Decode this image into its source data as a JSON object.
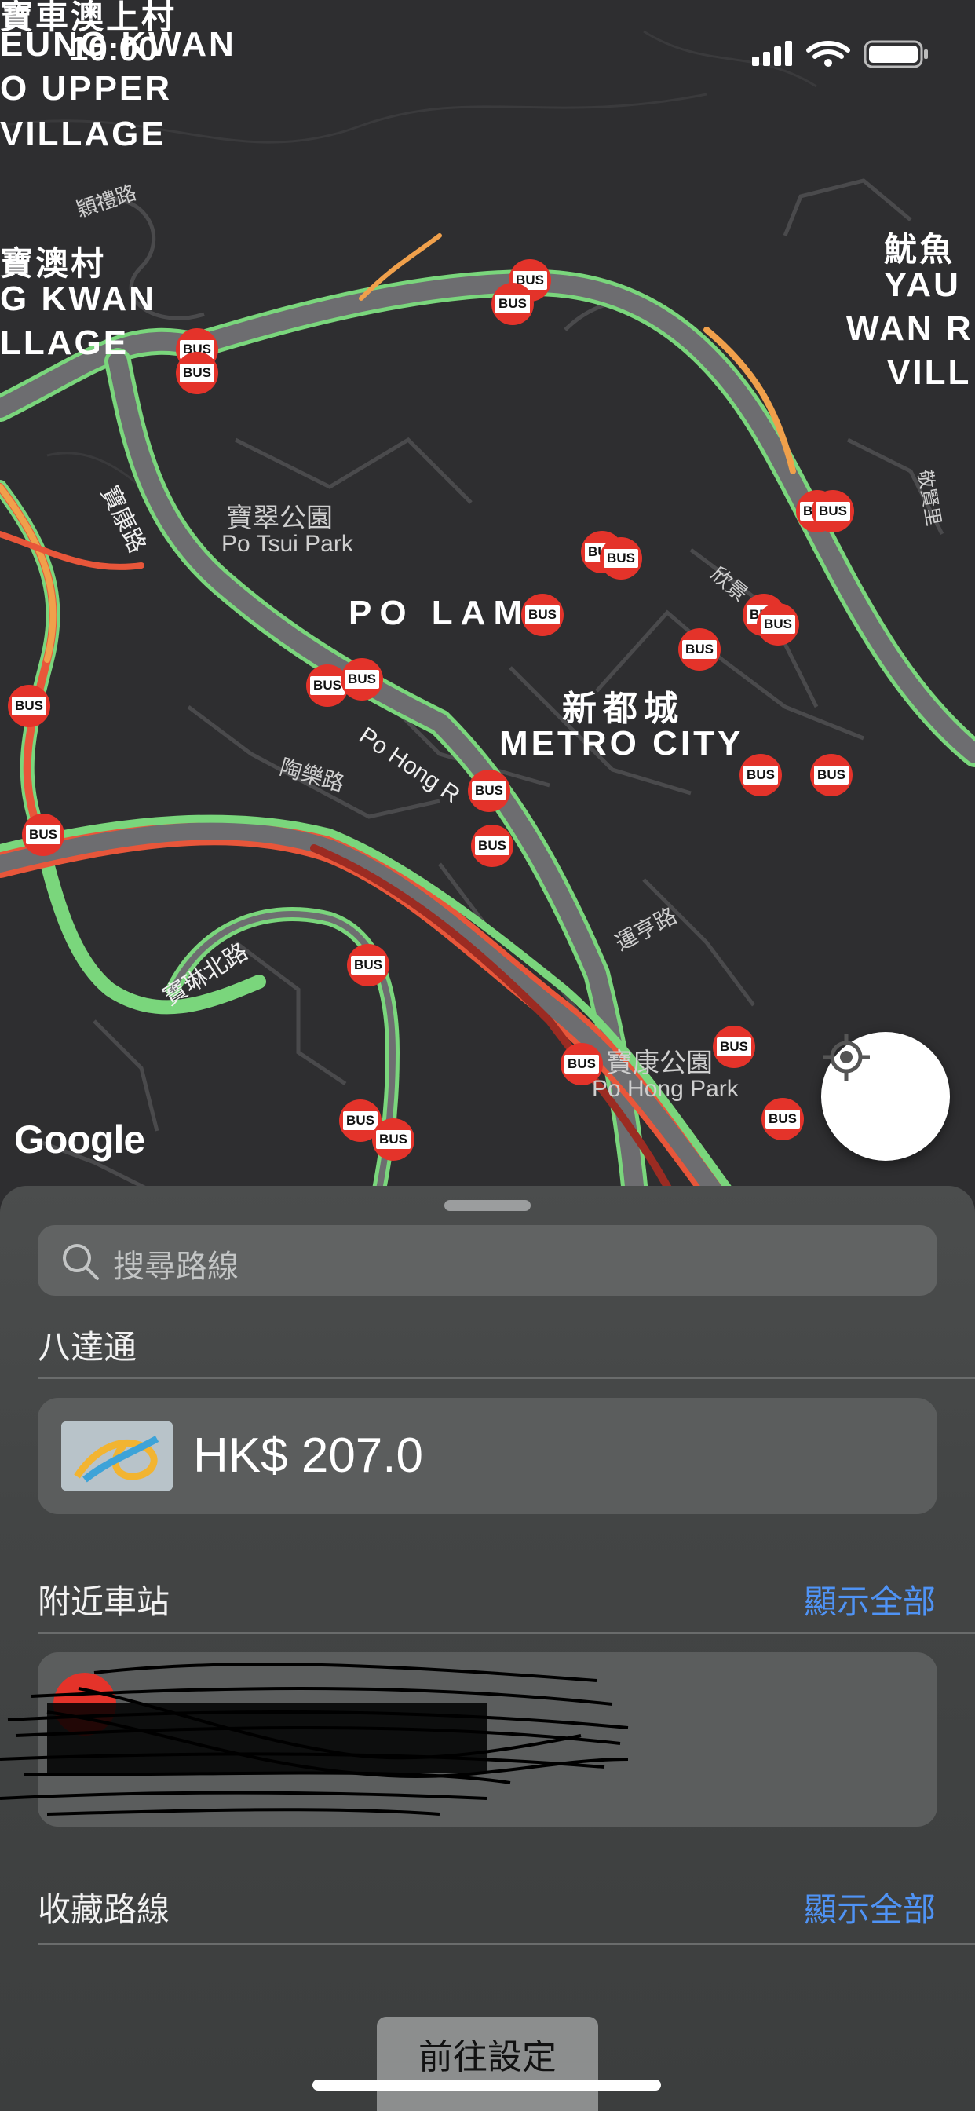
{
  "status_bar": {
    "time": "10:00"
  },
  "map": {
    "labels": {
      "upper_village_zh": "寶車澳上村",
      "upper_village_en1": "EUNG KWAN",
      "upper_village_en2": "O UPPER",
      "upper_village_en3": "VILLAGE",
      "village_zh": "寶澳村",
      "village_en1": "G KWAN",
      "village_en2": "LLAGE",
      "yau_yue_zh": "魷魚",
      "yau_yue_en1": "YAU",
      "yau_yue_en2": "WAN R",
      "yau_yue_en3": "VILL",
      "po_lam": "PO LAM",
      "metro_zh": "新都城",
      "metro_en": "METRO CITY",
      "po_tsui_zh": "寶翠公園",
      "po_tsui_en": "Po Tsui Park",
      "po_hong_zh": "寶康公園",
      "po_hong_en": "Po Hong Park",
      "po_hong_rd": "Po Hong R",
      "road1": "穎禮路",
      "road2": "寶康路",
      "road3": "陶樂路",
      "road4": "運亨路",
      "road5": "寶琳北路",
      "road6": "欣景",
      "road7": "敬賢里"
    },
    "bus_label": "BUS",
    "google": "Google"
  },
  "sheet": {
    "search_placeholder": "搜尋路線",
    "octopus": {
      "title": "八達通",
      "balance": "HK$ 207.0"
    },
    "nearby": {
      "title": "附近車站",
      "show_all": "顯示全部"
    },
    "favourites": {
      "title": "收藏路線",
      "show_all": "顯示全部"
    },
    "settings_button": "前往設定"
  },
  "colors": {
    "accent": "#4f93f5",
    "bus_red": "#e4332a"
  }
}
